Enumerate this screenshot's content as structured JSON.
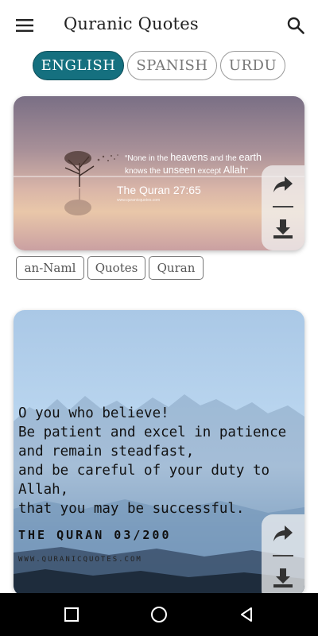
{
  "app": {
    "title": "Quranic Quotes"
  },
  "languages": [
    "ENGLISH",
    "SPANISH",
    "URDU"
  ],
  "selected_language": "ENGLISH",
  "cards": [
    {
      "quote_line1_parts": [
        "“None in the ",
        "heavens",
        " and the ",
        "earth"
      ],
      "quote_line2_parts": [
        "knows the ",
        "unseen",
        " except ",
        "Allah",
        "”"
      ],
      "reference": "The Quran 27:65",
      "website": "www.quranicquotes.com",
      "tags": [
        "an-Naml",
        "Quotes",
        "Quran"
      ]
    },
    {
      "quote_lines": [
        "O you who believe!",
        "Be patient and excel in patience",
        "and remain steadfast,",
        "and be careful of your duty to",
        "Allah,",
        "that you may be successful."
      ],
      "reference": "THE QURAN 03/200",
      "website": "WWW.QURANICQUOTES.COM"
    }
  ],
  "icons": {
    "menu": "hamburger-menu-icon",
    "search": "search-icon",
    "share": "share-arrow-icon",
    "download": "download-icon",
    "recent_apps": "square-icon",
    "home": "circle-icon",
    "back": "triangle-back-icon"
  },
  "colors": {
    "active_chip": "#15707f",
    "nav_bar": "#000000"
  }
}
